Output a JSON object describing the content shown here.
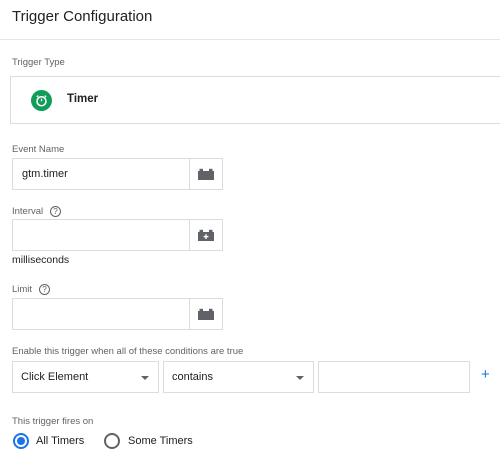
{
  "header": {
    "title": "Trigger Configuration"
  },
  "trigger_type": {
    "section_label": "Trigger Type",
    "selected": "Timer",
    "icon": "timer-icon",
    "icon_color": "#0f9d58"
  },
  "event_name": {
    "label": "Event Name",
    "value": "gtm.timer",
    "variable_button_icon": "variable-bricks-icon"
  },
  "interval": {
    "label": "Interval",
    "help_icon": "?",
    "value": "",
    "units": "milliseconds"
  },
  "limit": {
    "label": "Limit",
    "help_icon": "?",
    "value": ""
  },
  "conditions": {
    "label": "Enable this trigger when all of these conditions are true",
    "variable": "Click Element",
    "operator": "contains",
    "value": "",
    "add_symbol": "+"
  },
  "fires_on": {
    "label": "This trigger fires on",
    "options": [
      {
        "label": "All Timers",
        "checked": true
      },
      {
        "label": "Some Timers",
        "checked": false
      }
    ]
  },
  "colors": {
    "accent": "#1a73e8",
    "border": "#dadce0"
  }
}
